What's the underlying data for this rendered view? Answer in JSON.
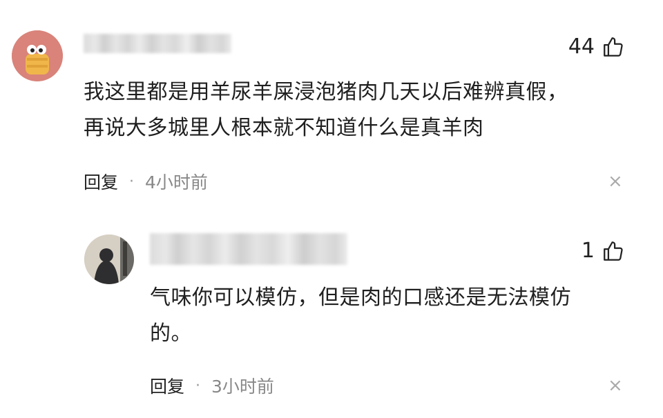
{
  "comments": [
    {
      "likes": "44",
      "text_line1": "我这里都是用羊尿羊屎浸泡猪肉几天以后难辨真假，",
      "text_line2": "再说大多城里人根本就不知道什么是真羊肉",
      "reply_label": "回复",
      "separator": "·",
      "time": "4小时前",
      "close": "×"
    },
    {
      "likes": "1",
      "text_line1": "气味你可以模仿，但是肉的口感还是无法模仿",
      "text_line2": "的。",
      "reply_label": "回复",
      "separator": "·",
      "time": "3小时前",
      "close": "×"
    }
  ],
  "colors": {
    "avatar1_bg": "#d9837a",
    "avatar2_bg": "#d6cfc3",
    "muted": "#888888"
  }
}
